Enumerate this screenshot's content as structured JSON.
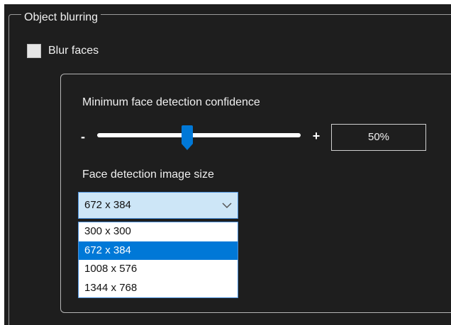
{
  "group": {
    "title": "Object blurring"
  },
  "blur_faces": {
    "label": "Blur faces",
    "checked": false
  },
  "confidence": {
    "label": "Minimum face detection confidence",
    "minus_label": "-",
    "plus_label": "+",
    "value_text": "50%",
    "level_percent": 45
  },
  "image_size": {
    "label": "Face detection image size",
    "selected": "672 x 384",
    "options": [
      "300 x 300",
      "672 x 384",
      "1008 x 576",
      "1344 x 768"
    ],
    "highlighted_index": 1
  },
  "colors": {
    "background": "#1e1e1e",
    "accent": "#0078d7",
    "combo_fill": "#cde6f7"
  },
  "icons": {
    "dropdown": "chevron-down-icon",
    "thumb": "slider-thumb"
  }
}
